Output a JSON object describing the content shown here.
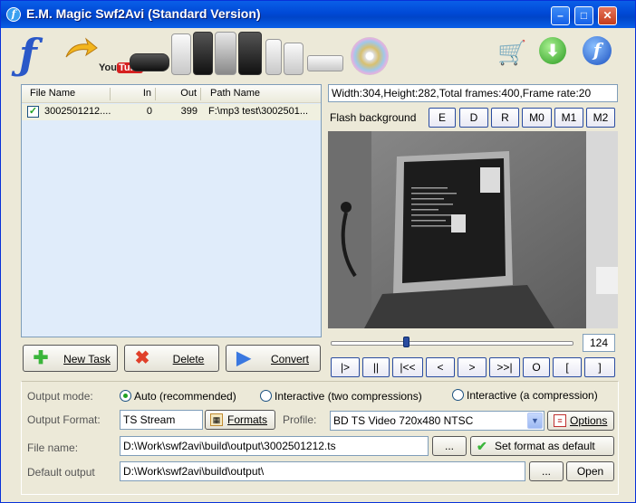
{
  "window": {
    "title": "E.M. Magic Swf2Avi (Standard Version)"
  },
  "file_list": {
    "columns": [
      "File Name",
      "In",
      "Out",
      "Path Name"
    ],
    "rows": [
      {
        "checked": true,
        "file_name": "3002501212....",
        "in": "0",
        "out": "399",
        "path": "F:\\mp3 test\\3002501..."
      }
    ]
  },
  "actions": {
    "new_task": "New Task",
    "delete": "Delete",
    "convert": "Convert"
  },
  "preview": {
    "info": "Width:304,Height:282,Total frames:400,Frame rate:20",
    "flash_bg_label": "Flash background",
    "bg_buttons": [
      "E",
      "D",
      "R",
      "M0",
      "M1",
      "M2"
    ],
    "frame": "124",
    "slider_fraction": 0.31
  },
  "playback": [
    "|>",
    "||",
    "|<<",
    "<",
    ">",
    ">>|",
    "O",
    "[",
    "]"
  ],
  "output": {
    "mode_label": "Output mode:",
    "modes": [
      "Auto (recommended)",
      "Interactive (two compressions)",
      "Interactive (a compression)"
    ],
    "format_label": "Output Format:",
    "format_value": "TS Stream",
    "formats_btn": "Formats",
    "profile_label": "Profile:",
    "profile_value": "BD TS Video 720x480 NTSC",
    "options_btn": "Options",
    "filename_label": "File name:",
    "filename_value": "D:\\Work\\swf2avi\\build\\output\\3002501212.ts",
    "browse": "...",
    "set_default_btn": "Set format as default",
    "default_output_label": "Default output",
    "default_output_value": "D:\\Work\\swf2avi\\build\\output\\",
    "open_btn": "Open"
  },
  "colors": {
    "titlebar": "#0a5fe8",
    "face": "#ece9d8",
    "list_bg": "#e0ecfa"
  }
}
